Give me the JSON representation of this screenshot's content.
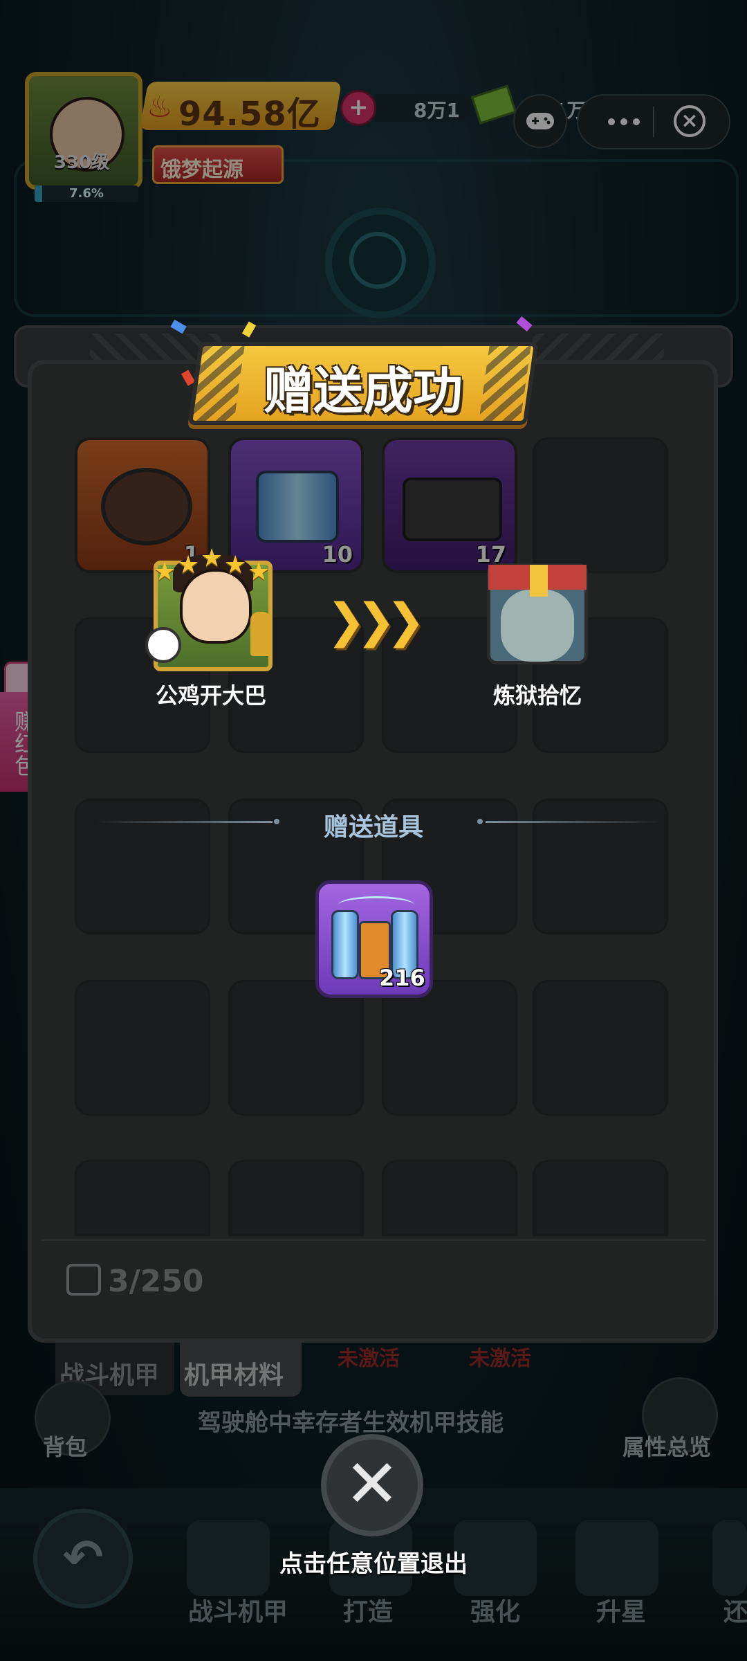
{
  "hud": {
    "power": "94.58亿",
    "level": "330级",
    "progress_text": "7.6%",
    "progress_value": 0.076,
    "title_badge": "饿梦起源",
    "gem_amount": "8万1",
    "cash_amount": "1万5"
  },
  "side_widget": {
    "label": "赚红包"
  },
  "popup": {
    "banner": "赠送成功",
    "giver_name": "公鸡开大巴",
    "receiver_name": "炼狱拾忆",
    "arrows": "❯❯❯",
    "section_title": "赠送道具",
    "gift_count": "216",
    "exit_hint": "点击任意位置退出",
    "close_symbol": "✕"
  },
  "inventory": {
    "items": [
      {
        "name": "mech-core",
        "count": "1",
        "color": "#c45a24"
      },
      {
        "name": "battery-pack",
        "count": "10",
        "color": "#6a3aa8"
      },
      {
        "name": "armor-plate",
        "count": "17",
        "color": "#5a2f86"
      }
    ],
    "capacity": "3/250"
  },
  "tabs": {
    "battle": "战斗机甲",
    "material": "机甲材料",
    "inactive_1": "未激活",
    "inactive_2": "未激活",
    "tip": "驾驶舱中幸存者生效机甲技能",
    "bag": "背包",
    "attributes": "属性总览"
  },
  "nav": {
    "items": [
      "战斗机甲",
      "打造",
      "强化",
      "升星",
      "还"
    ]
  },
  "colors": {
    "banner_yellow": "#f4c840",
    "panel": "#3a3b3c",
    "gift_purple": "#8b4fd0",
    "section_blue": "#a9c6de"
  }
}
